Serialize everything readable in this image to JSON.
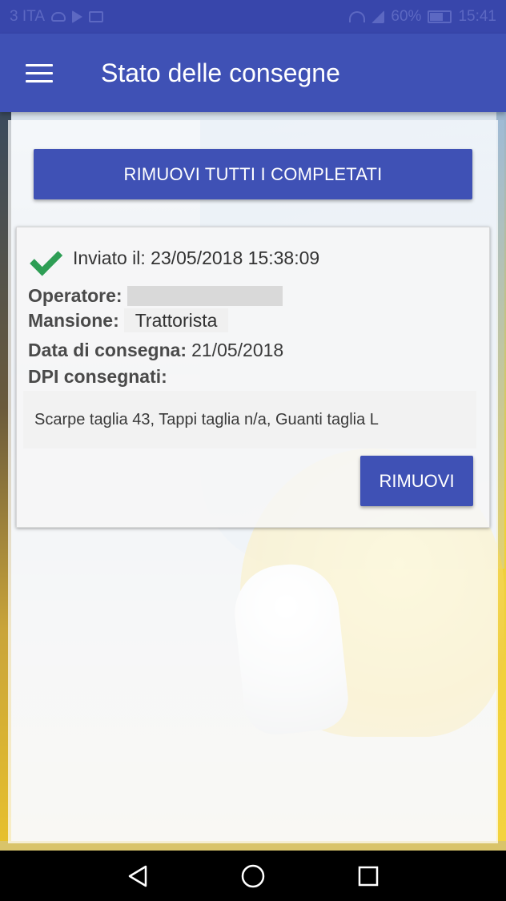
{
  "status_bar": {
    "carrier": "3 ITA",
    "battery": "60%",
    "time": "15:41",
    "color": "#3846ab"
  },
  "toolbar": {
    "title": "Stato delle consegne",
    "menu_icon": "hamburger-menu-icon",
    "color": "#3f51b5"
  },
  "actions": {
    "remove_all_completed": "RIMUOVI TUTTI I COMPLETATI"
  },
  "delivery": {
    "status_icon": "check-icon",
    "status_color": "#2e9e55",
    "sent_label": "Inviato il: 23/05/2018 15:38:09",
    "operatore_label": "Operatore:",
    "mansione_label": "Mansione:",
    "mansione_value": "Trattorista",
    "data_label": "Data di consegna:",
    "data_value": "21/05/2018",
    "dpi_label": "DPI consegnati:",
    "dpi_value": "Scarpe taglia 43, Tappi taglia n/a, Guanti taglia L",
    "remove_button": "RIMUOVI"
  },
  "nav": {
    "back_icon": "back-triangle-icon",
    "home_icon": "home-circle-icon",
    "recents_icon": "recents-square-icon"
  }
}
